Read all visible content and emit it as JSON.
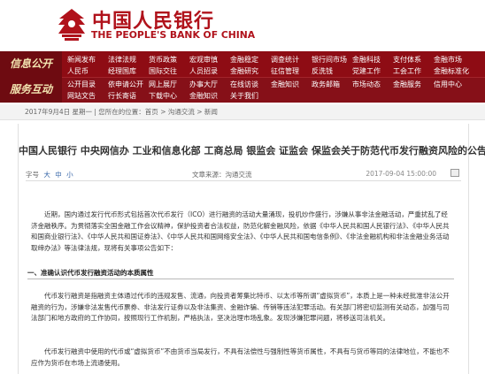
{
  "header": {
    "logo_cn": "中国人民银行",
    "logo_en": "THE PEOPLE'S BANK OF CHINA"
  },
  "nav": {
    "tag1": "信息公开",
    "tag2": "服务互动",
    "row1": [
      "新闻发布",
      "法律法规",
      "货币政策",
      "宏观审慎",
      "金融稳定",
      "调查统计",
      "银行间市场",
      "金融科技",
      "支付体系",
      "金融市场"
    ],
    "row2": [
      "人民币",
      "经理国库",
      "国际交往",
      "人员招录",
      "金融研究",
      "征信管理",
      "反洗钱",
      "党建工作",
      "工会工作",
      "金融标准化"
    ],
    "row3": [
      "公开目录",
      "依申请公开",
      "网上展厅",
      "办事大厅",
      "在线访谈",
      "金融知识",
      "政务邮箱",
      "市场动态",
      "金融服务",
      "信用中心"
    ],
    "row4": [
      "网站文告",
      "行长寄语",
      "下载中心",
      "金融知识",
      "关于我们"
    ]
  },
  "breadcrumb": "2017年9月4日 星期一 | 您所在的位置：首页 > 沟通交流 > 新闻",
  "article": {
    "title": "中国人民银行 中央网信办 工业和信息化部 工商总局 银监会 证监会 保监会关于防范代币发行融资风险的公告",
    "font_size_label": "字号",
    "font_sizes": [
      "大",
      "中",
      "小"
    ],
    "source": "文章来源：沟通交流",
    "date": "2017-09-04 15:00:00",
    "para1": "近期，国内通过发行代币形式包括首次代币发行（ICO）进行融资的活动大量涌现，投机炒作盛行，涉嫌从事非法金融活动，严重扰乱了经济金融秩序。为贯彻落实全国金融工作会议精神，保护投资者合法权益，防范化解金融风险，依据《中华人民共和国人民银行法》、《中华人民共和国商业银行法》、《中华人民共和国证券法》、《中华人民共和国网络安全法》、《中华人民共和国电信条例》、《非法金融机构和非法金融业务活动取缔办法》等法律法规，现将有关事项公告如下：",
    "section1": "一、准确认识代币发行融资活动的本质属性",
    "para2": "代币发行融资是指融资主体通过代币的违规发售、流通，向投资者筹集比特币、以太币等所谓“虚拟货币”，本质上是一种未经批准非法公开融资的行为，涉嫌非法发售代币票券、非法发行证券以及非法集资、金融诈骗、传销等违法犯罪活动。有关部门将密切监测有关动态，加强与司法部门和地方政府的工作协同，按照现行工作机制，严格执法，坚决治理市场乱象。发现涉嫌犯罪问题，将移送司法机关。",
    "para3": "代币发行融资中使用的代币或“虚拟货币”不由货币当局发行，不具有法偿性与强制性等货币属性，不具有与货币等同的法律地位，不能也不应作为货币在市场上流通使用。"
  }
}
